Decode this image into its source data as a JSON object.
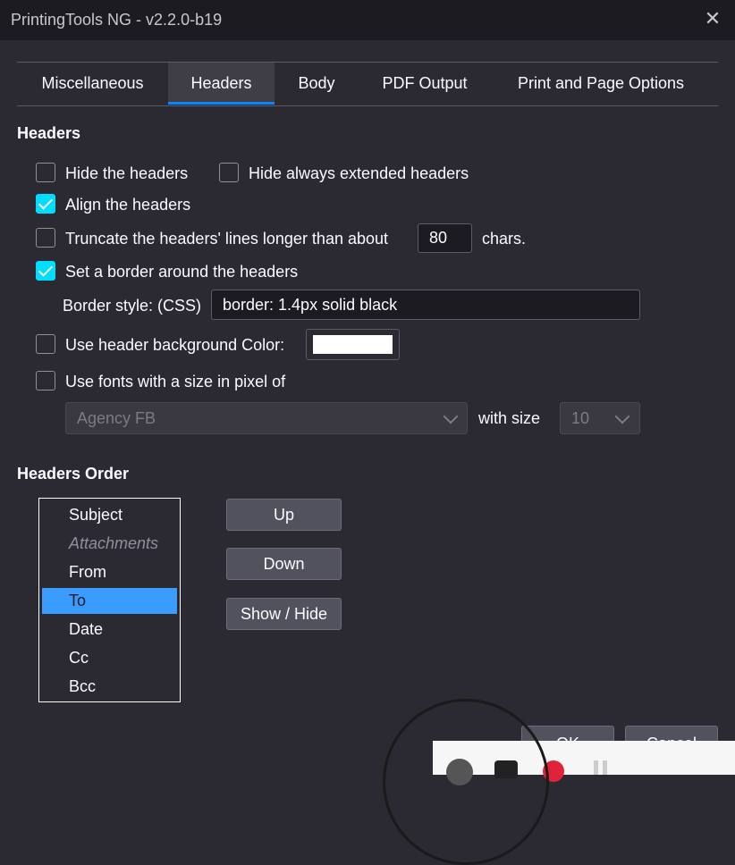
{
  "window": {
    "title": "PrintingTools NG - v2.2.0-b19",
    "close_glyph": "✕"
  },
  "tabs": [
    {
      "label": "Miscellaneous"
    },
    {
      "label": "Headers"
    },
    {
      "label": "Body"
    },
    {
      "label": "PDF Output"
    },
    {
      "label": "Print and Page Options"
    }
  ],
  "active_tab": "Headers",
  "headers_section": {
    "title": "Headers",
    "hide_headers": {
      "label": "Hide the headers",
      "checked": false
    },
    "hide_extended": {
      "label": "Hide always extended headers",
      "checked": false
    },
    "align_headers": {
      "label": "Align the headers",
      "checked": true
    },
    "truncate": {
      "label": "Truncate the headers' lines longer than about",
      "checked": false,
      "value": "80",
      "suffix": "chars."
    },
    "border": {
      "label": "Set a border around the headers",
      "checked": true
    },
    "border_style": {
      "label": "Border style: (CSS)",
      "value": "border: 1.4px solid black"
    },
    "bg_color": {
      "label": "Use header background Color:",
      "checked": false,
      "color": "#ffffff"
    },
    "fonts": {
      "label": "Use fonts with a size in pixel of",
      "checked": false
    },
    "font_family": "Agency FB",
    "with_size_label": "with size",
    "font_size": "10"
  },
  "order_section": {
    "title": "Headers Order",
    "items": [
      {
        "label": "Subject",
        "hidden": false,
        "selected": false
      },
      {
        "label": "Attachments",
        "hidden": true,
        "selected": false
      },
      {
        "label": "From",
        "hidden": false,
        "selected": false
      },
      {
        "label": "To",
        "hidden": false,
        "selected": true
      },
      {
        "label": "Date",
        "hidden": false,
        "selected": false
      },
      {
        "label": "Cc",
        "hidden": false,
        "selected": false
      },
      {
        "label": "Bcc",
        "hidden": false,
        "selected": false
      }
    ],
    "up_label": "Up",
    "down_label": "Down",
    "toggle_label": "Show / Hide"
  },
  "footer": {
    "ok_label": "OK",
    "cancel_label": "Cancel"
  },
  "colors": {
    "accent": "#0a84ff",
    "check": "#00ddff",
    "selection": "#3b9cff"
  }
}
